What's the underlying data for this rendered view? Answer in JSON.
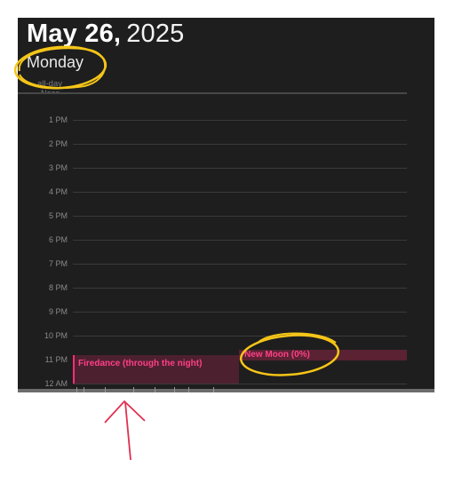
{
  "header": {
    "date": "May 26,",
    "year": "2025",
    "weekday": "Monday"
  },
  "all_day": {
    "label": "all-day",
    "noon_label": "Noon"
  },
  "hours": [
    "1 PM",
    "2 PM",
    "3 PM",
    "4 PM",
    "5 PM",
    "6 PM",
    "7 PM",
    "8 PM",
    "9 PM",
    "10 PM",
    "11 PM",
    "12 AM"
  ],
  "events": {
    "firedance": {
      "title": "Firedance (through the night)",
      "color": "#ff2d78"
    },
    "new_moon": {
      "title": "New Moon (0%)",
      "color": "#ff2d78"
    }
  },
  "annotation": {
    "circle_color": "#f5c518",
    "arrow_color": "#e0304f"
  }
}
